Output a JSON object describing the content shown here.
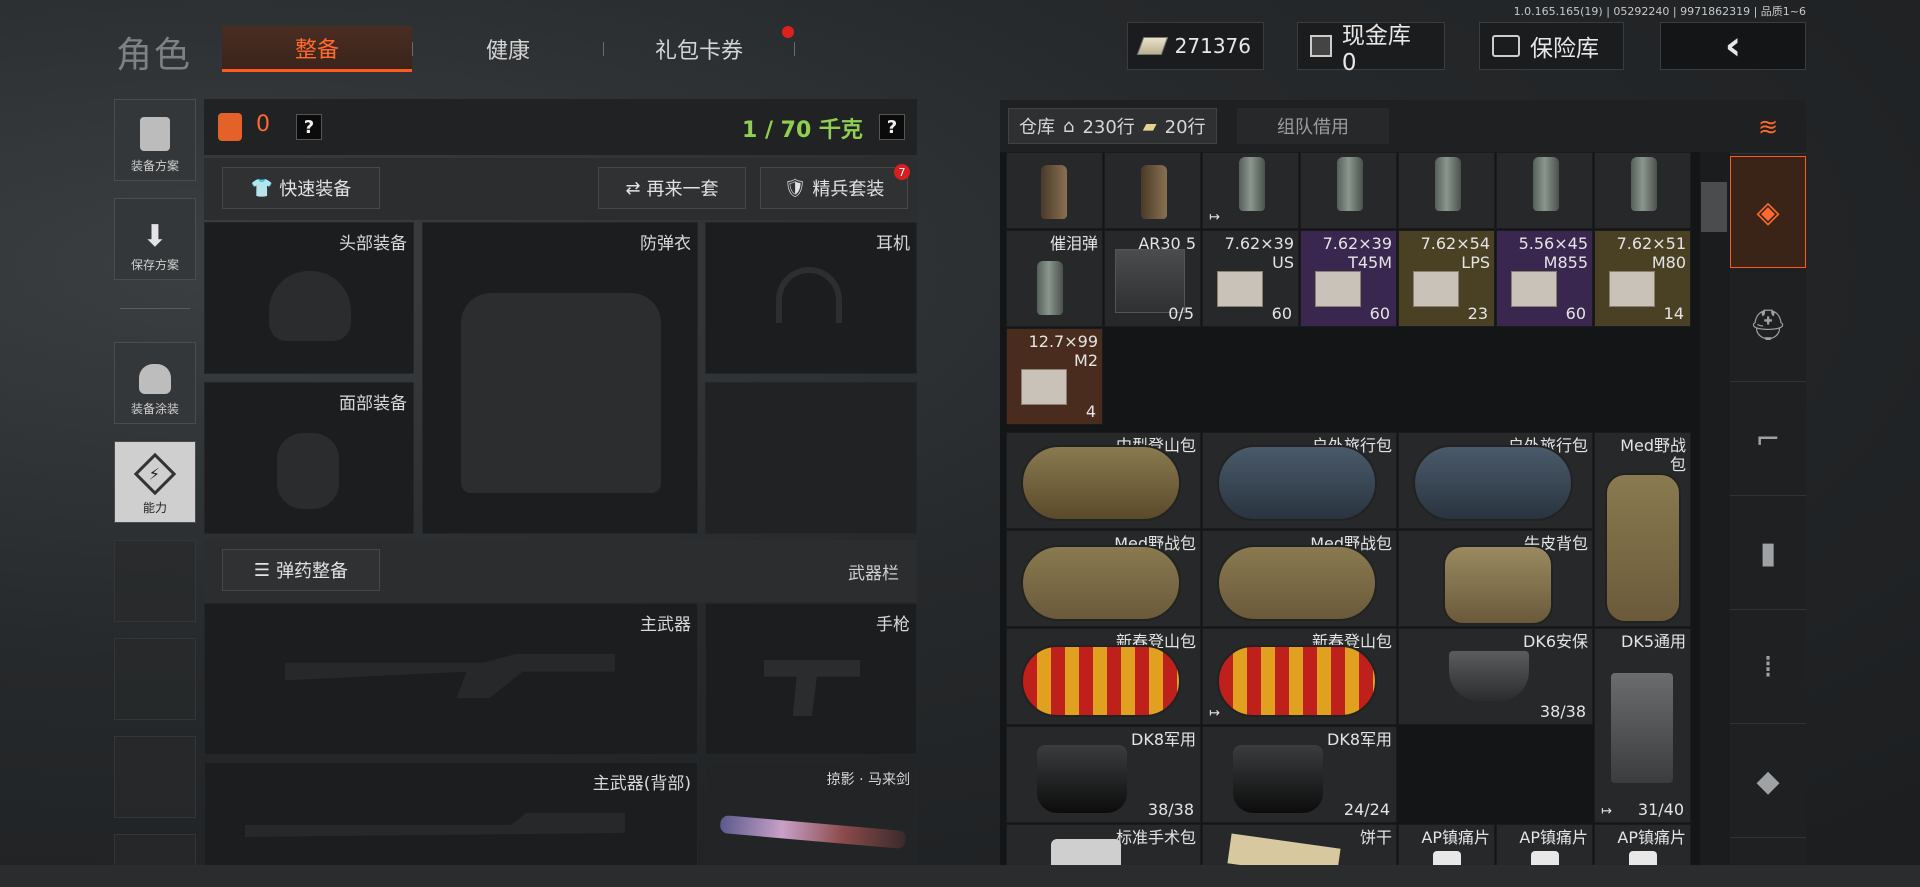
{
  "header": {
    "title": "角色",
    "tabs": [
      {
        "label": "整备",
        "active": true
      },
      {
        "label": "健康",
        "active": false
      },
      {
        "label": "礼包卡券",
        "active": false,
        "notify": true
      }
    ],
    "version": "1.0.165.165(19) | 05292240 | 9971862319 | 品质1~6",
    "money": "271376",
    "cash_vault": "现金库 0",
    "safe_box": "保险库",
    "back_icon": "chevron-left-icon"
  },
  "left_menu": [
    {
      "label": "装备方案",
      "icon": "vest-icon"
    },
    {
      "label": "保存方案",
      "icon": "download-icon"
    },
    {
      "label": "装备涂装",
      "icon": "helmet-skin-icon"
    },
    {
      "label": "能力",
      "icon": "ability-icon",
      "selected": true
    }
  ],
  "loadout": {
    "armor_value": "0",
    "help": "?",
    "weight": "1 / 70 千克",
    "quick_equip": "快速装备",
    "again_set": "再来一套",
    "elite_set": "精兵套装",
    "elite_badge": "7",
    "slots": {
      "head": "头部装备",
      "armor": "防弹衣",
      "headset": "耳机",
      "face": "面部装备"
    },
    "ammo_btn": "弹药整备",
    "weapon_bar": "武器栏",
    "weapons": {
      "primary": "主武器",
      "pistol": "手枪",
      "primary_back": "主武器(背部)",
      "melee": "掠影 · 马来剑"
    }
  },
  "storage": {
    "tab_label": "仓库",
    "rows_home": "230行",
    "rows_extra": "20行",
    "team_borrow": "组队借用",
    "items": [
      {
        "name": "催泪弹",
        "count": ""
      },
      {
        "name": "AR30 5",
        "count": "0/5"
      },
      {
        "name": "7.62×39 US",
        "count": "60"
      },
      {
        "name": "7.62×39 T45M",
        "count": "60"
      },
      {
        "name": "7.62×54 LPS",
        "count": "23"
      },
      {
        "name": "5.56×45 M855",
        "count": "60"
      },
      {
        "name": "7.62×51 M80",
        "count": "14"
      },
      {
        "name": "12.7×99 M2",
        "count": "4"
      },
      {
        "name": "中型登山包",
        "count": ""
      },
      {
        "name": "户外旅行包",
        "count": ""
      },
      {
        "name": "户外旅行包",
        "count": ""
      },
      {
        "name": "Med野战包",
        "count": ""
      },
      {
        "name": "Med野战包",
        "count": ""
      },
      {
        "name": "Med野战包",
        "count": ""
      },
      {
        "name": "牛皮背包",
        "count": ""
      },
      {
        "name": "新春登山包",
        "count": ""
      },
      {
        "name": "新春登山包",
        "count": ""
      },
      {
        "name": "DK6安保",
        "count": "38/38"
      },
      {
        "name": "DK5通用",
        "count": "31/40"
      },
      {
        "name": "DK8军用",
        "count": "38/38"
      },
      {
        "name": "DK8军用",
        "count": "24/24"
      },
      {
        "name": "标准手术包",
        "count": ""
      },
      {
        "name": "饼干",
        "count": ""
      },
      {
        "name": "AP镇痛片",
        "count": ""
      },
      {
        "name": "AP镇痛片",
        "count": ""
      },
      {
        "name": "AP镇痛片",
        "count": ""
      }
    ]
  },
  "colors": {
    "accent": "#ff5a1e",
    "weight_green": "#8fd14f",
    "purple": "#3a2750",
    "gold": "#4a4124"
  }
}
